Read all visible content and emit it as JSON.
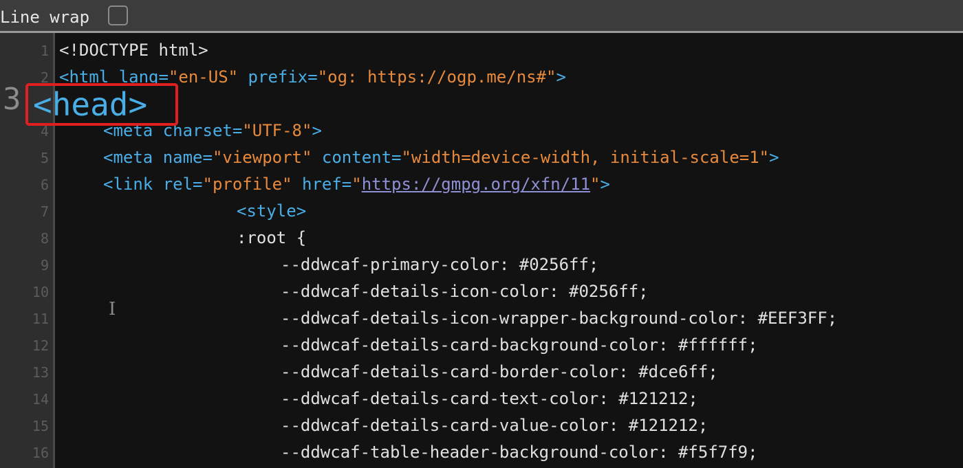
{
  "toolbar": {
    "line_wrap_label": "Line wrap"
  },
  "highlight_color": "#e02020",
  "editor": {
    "line_numbers": [
      "1",
      "2",
      "3",
      "4",
      "5",
      "6",
      "7",
      "8",
      "9",
      "10",
      "11",
      "12",
      "13",
      "14",
      "15",
      "16"
    ],
    "lines": [
      [
        {
          "t": "<!DOCTYPE html>",
          "c": "text"
        }
      ],
      [
        {
          "t": "<html ",
          "c": "tag"
        },
        {
          "t": "lang=",
          "c": "attr"
        },
        {
          "t": "\"en-US\"",
          "c": "str"
        },
        {
          "t": " prefix=",
          "c": "attr"
        },
        {
          "t": "\"og: https://ogp.me/ns#\"",
          "c": "str"
        },
        {
          "t": ">",
          "c": "tag"
        }
      ],
      [
        {
          "t": "<head>",
          "c": "tag"
        }
      ],
      [
        {
          "t": "<meta ",
          "c": "tag"
        },
        {
          "t": "charset=",
          "c": "attr"
        },
        {
          "t": "\"UTF-8\"",
          "c": "str"
        },
        {
          "t": ">",
          "c": "tag"
        }
      ],
      [
        {
          "t": "<meta ",
          "c": "tag"
        },
        {
          "t": "name=",
          "c": "attr"
        },
        {
          "t": "\"viewport\"",
          "c": "str"
        },
        {
          "t": " content=",
          "c": "attr"
        },
        {
          "t": "\"width=device-width, initial-scale=1\"",
          "c": "str"
        },
        {
          "t": ">",
          "c": "tag"
        }
      ],
      [
        {
          "t": "<link ",
          "c": "tag"
        },
        {
          "t": "rel=",
          "c": "attr"
        },
        {
          "t": "\"profile\"",
          "c": "str"
        },
        {
          "t": " href=",
          "c": "attr"
        },
        {
          "t": "\"",
          "c": "str"
        },
        {
          "t": "https://gmpg.org/xfn/11",
          "c": "link"
        },
        {
          "t": "\"",
          "c": "str"
        },
        {
          "t": ">",
          "c": "tag"
        }
      ],
      [
        {
          "t": "<style>",
          "c": "tag"
        }
      ],
      [
        {
          "t": ":root {",
          "c": "text"
        }
      ],
      [
        {
          "t": "--ddwcaf-primary-color: #0256ff;",
          "c": "text"
        }
      ],
      [
        {
          "t": "--ddwcaf-details-icon-color: #0256ff;",
          "c": "text"
        }
      ],
      [
        {
          "t": "--ddwcaf-details-icon-wrapper-background-color: #EEF3FF;",
          "c": "text"
        }
      ],
      [
        {
          "t": "--ddwcaf-details-card-background-color: #ffffff;",
          "c": "text"
        }
      ],
      [
        {
          "t": "--ddwcaf-details-card-border-color: #dce6ff;",
          "c": "text"
        }
      ],
      [
        {
          "t": "--ddwcaf-details-card-text-color: #121212;",
          "c": "text"
        }
      ],
      [
        {
          "t": "--ddwcaf-details-card-value-color: #121212;",
          "c": "text"
        }
      ],
      [
        {
          "t": "--ddwcaf-table-header-background-color: #f5f7f9;",
          "c": "text"
        }
      ]
    ],
    "text_cursor_glyph": "I"
  }
}
